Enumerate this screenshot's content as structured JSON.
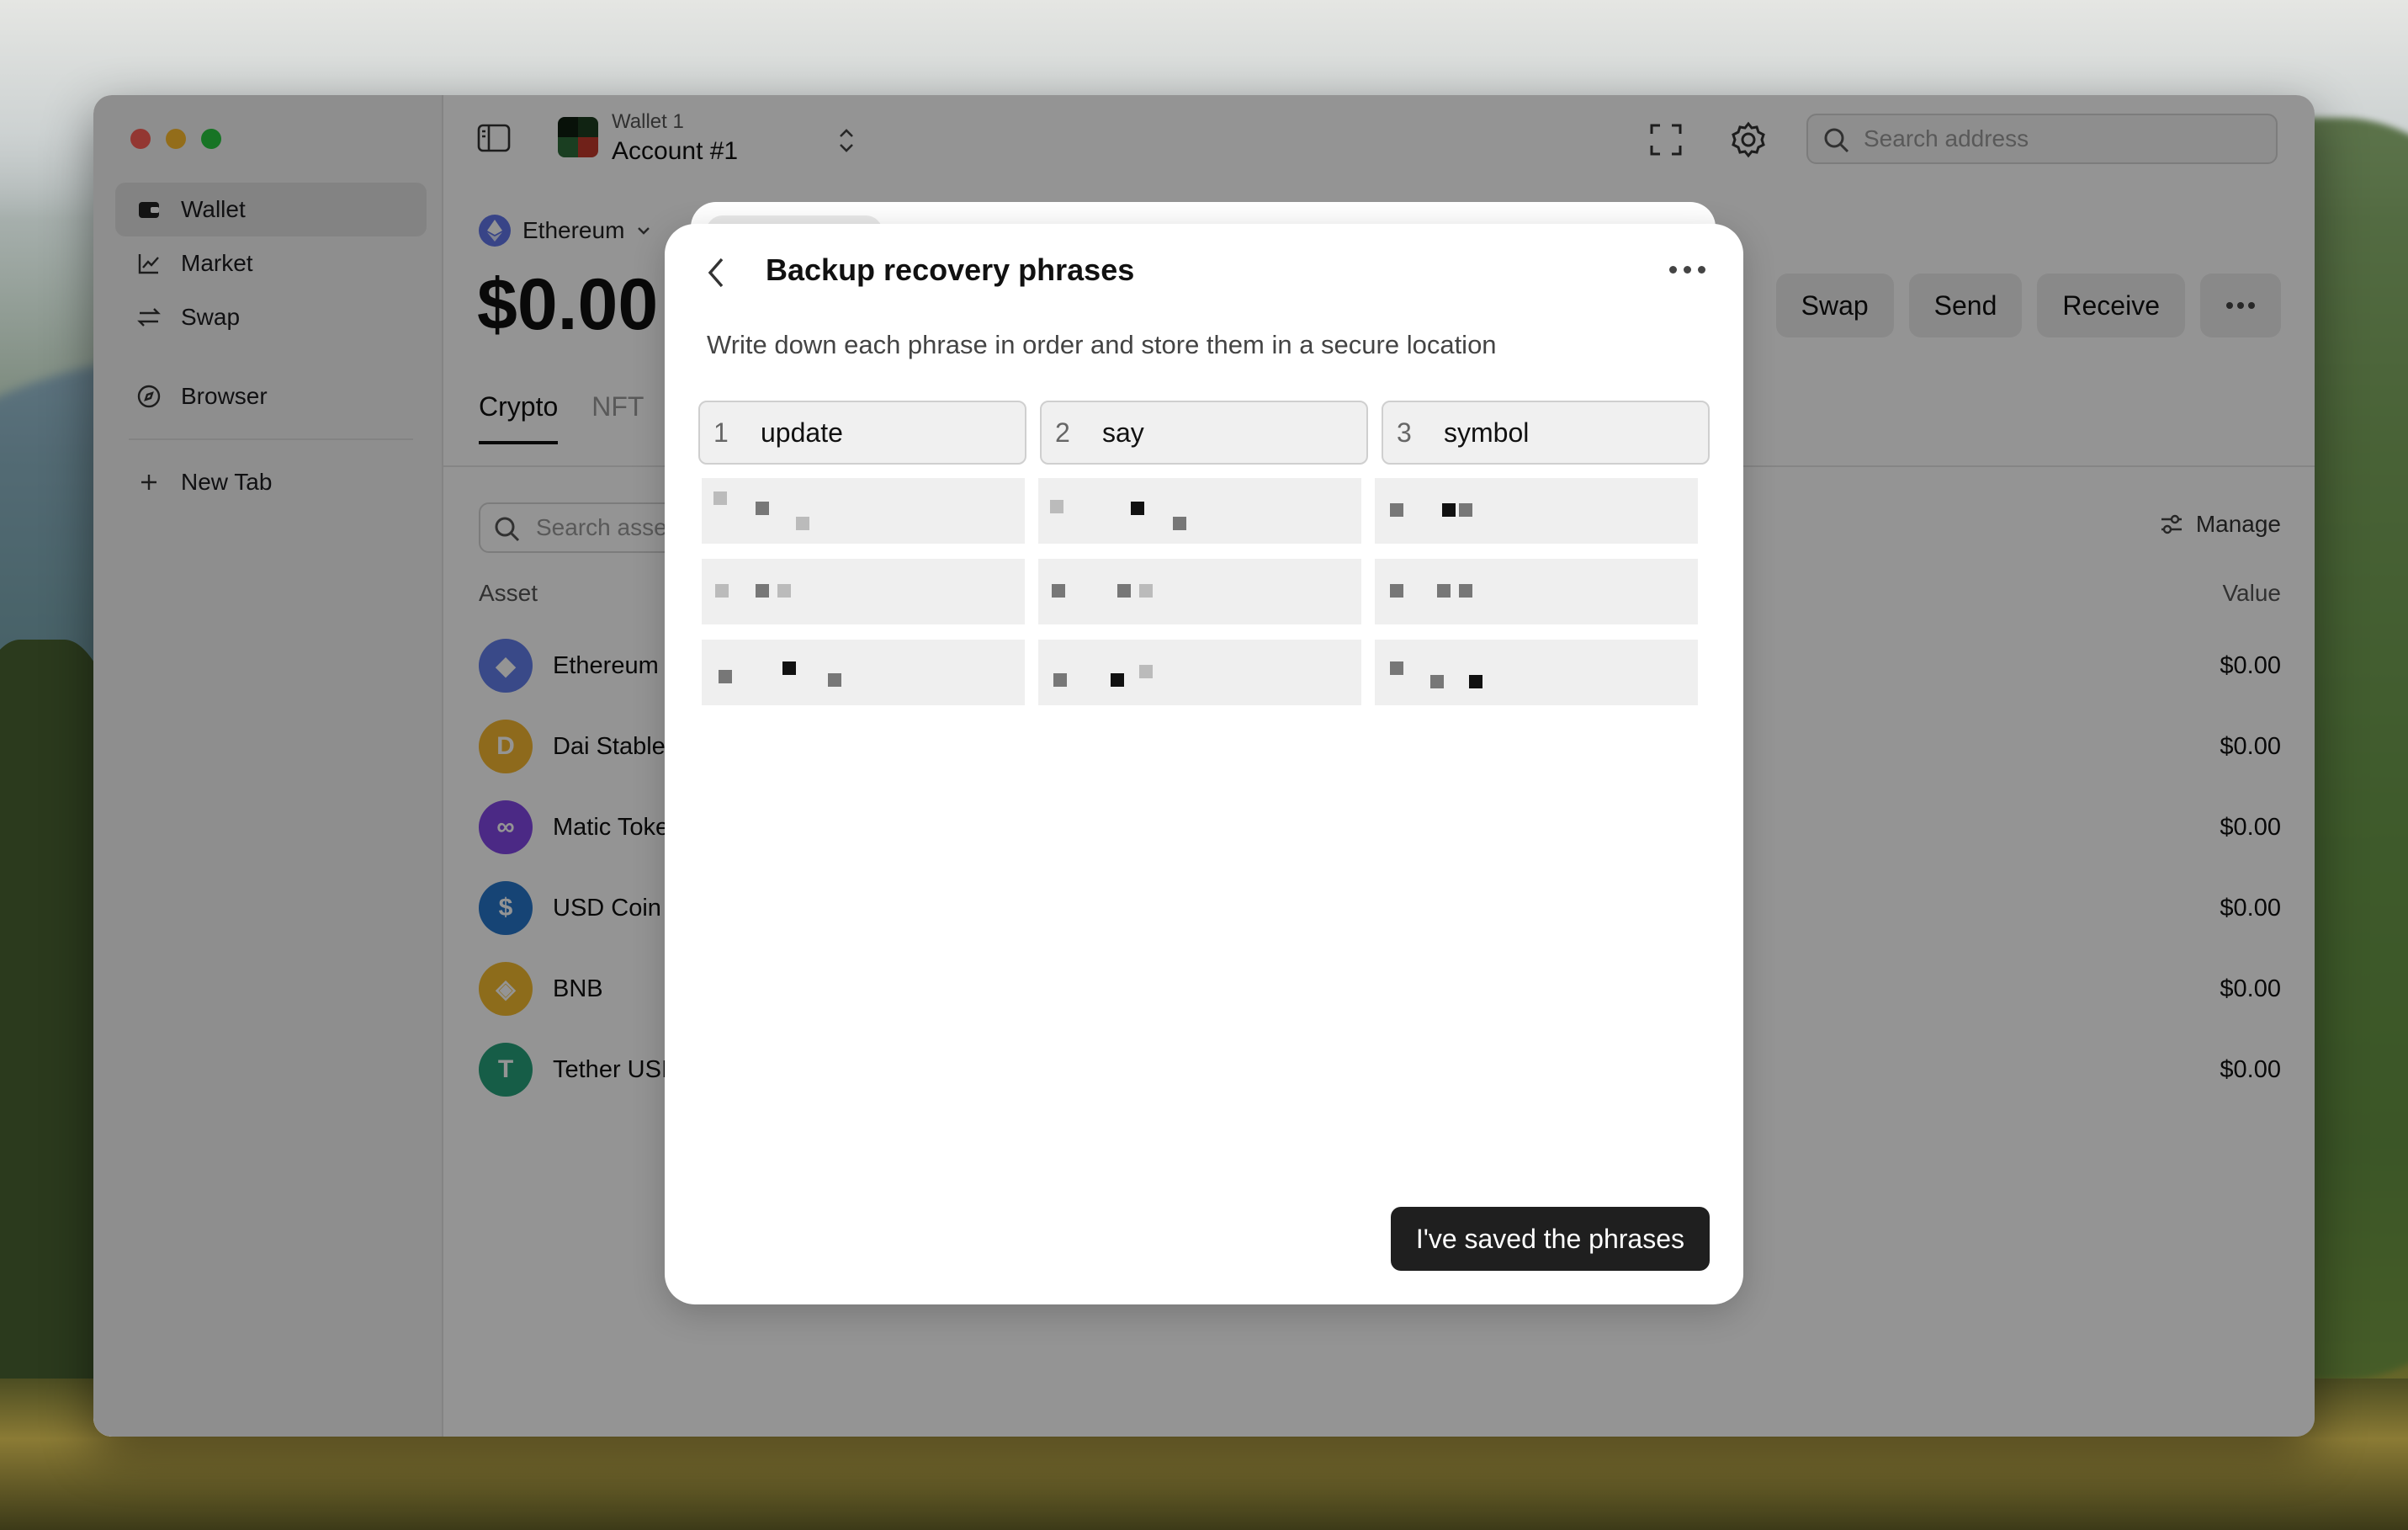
{
  "sidebar": {
    "items": [
      {
        "label": "Wallet",
        "icon": "wallet-icon"
      },
      {
        "label": "Market",
        "icon": "chart-icon"
      },
      {
        "label": "Swap",
        "icon": "swap-icon"
      },
      {
        "label": "Browser",
        "icon": "compass-icon"
      },
      {
        "label": "New Tab",
        "icon": "plus-icon"
      }
    ]
  },
  "header": {
    "wallet_name": "Wallet 1",
    "account_name": "Account #1",
    "search_placeholder": "Search address"
  },
  "main": {
    "network": "Ethereum",
    "balance": "$0.00",
    "actions": [
      "Swap",
      "Send",
      "Receive"
    ],
    "tabs": [
      "Crypto",
      "NFT"
    ],
    "asset_search_placeholder": "Search asse",
    "manage_label": "Manage",
    "columns": {
      "asset": "Asset",
      "value": "Value"
    },
    "assets": [
      {
        "name": "Ethereum",
        "value": "$0.00",
        "color": "#627eea",
        "glyph": "◆"
      },
      {
        "name": "Dai Stable",
        "value": "$0.00",
        "color": "#f4b731",
        "glyph": "D"
      },
      {
        "name": "Matic Toke",
        "value": "$0.00",
        "color": "#8247e5",
        "glyph": "∞"
      },
      {
        "name": "USD Coin",
        "value": "$0.00",
        "color": "#2775ca",
        "glyph": "$"
      },
      {
        "name": "BNB",
        "value": "$0.00",
        "color": "#f3ba2f",
        "glyph": "◈"
      },
      {
        "name": "Tether USI",
        "value": "$0.00",
        "color": "#26a17b",
        "glyph": "T"
      }
    ]
  },
  "modal": {
    "title": "Backup recovery phrases",
    "subtitle": "Write down each phrase in order and store them in a secure location",
    "phrases": [
      {
        "num": "1",
        "word": "update"
      },
      {
        "num": "2",
        "word": "say"
      },
      {
        "num": "3",
        "word": "symbol"
      }
    ],
    "confirm_label": "I've saved the phrases"
  },
  "colors": {
    "accent_dark": "#1f1f1f",
    "sidebar_bg": "#f5f5f5",
    "traffic_red": "#fe5f57",
    "traffic_yellow": "#febc2e",
    "traffic_green": "#28c840"
  }
}
